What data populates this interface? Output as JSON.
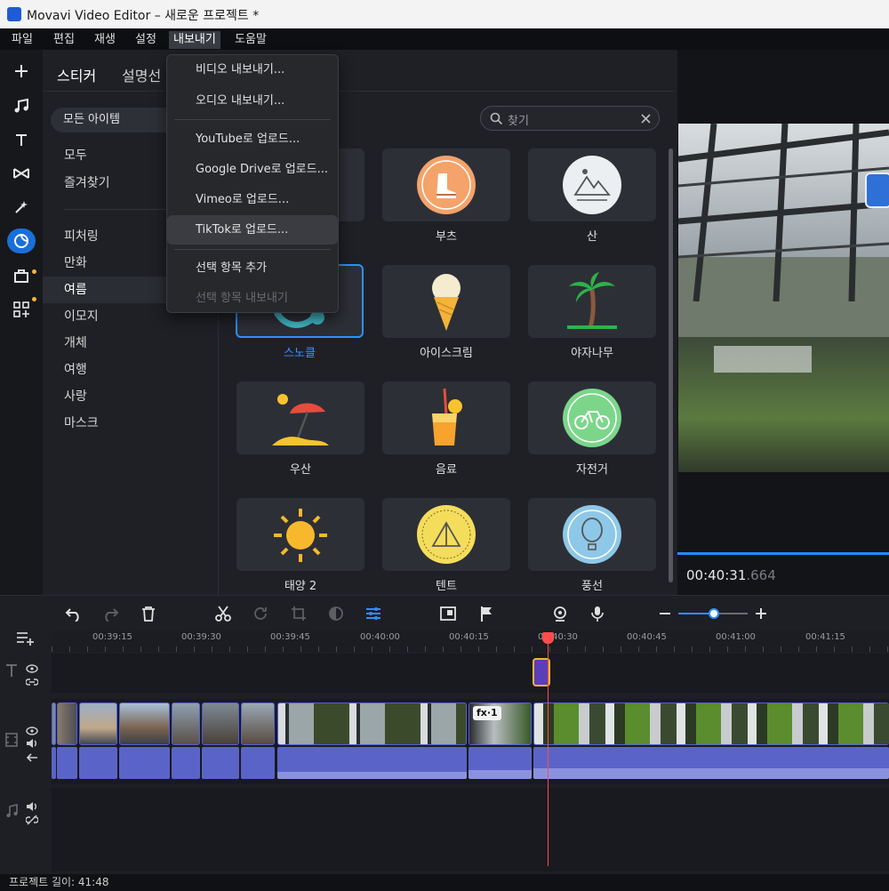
{
  "window": {
    "title": "Movavi Video Editor – 새로운 프로젝트 *"
  },
  "menu": [
    "파일",
    "편집",
    "재생",
    "설정",
    "내보내기",
    "도움말"
  ],
  "panel": {
    "tabs": [
      "스티커",
      "설명선"
    ],
    "filter_pill": "모든 아이템",
    "search_placeholder": "찾기",
    "categories_top": [
      "모두",
      "즐겨찾기"
    ],
    "categories": [
      "피처링",
      "만화",
      "여름",
      "이모지",
      "개체",
      "여행",
      "사랑",
      "마스크"
    ],
    "selected_category": "여름",
    "stickers": [
      "부츠",
      "산",
      "스노클",
      "아이스크림",
      "야자나무",
      "우산",
      "음료",
      "자전거",
      "태양 2",
      "텐트",
      "풍선"
    ]
  },
  "export_menu": {
    "items": [
      "비디오 내보내기...",
      "오디오 내보내기...",
      "YouTube로 업로드...",
      "Google Drive로 업로드...",
      "Vimeo로 업로드...",
      "TikTok로 업로드...",
      "선택 항목 추가",
      "선택 항목 내보내기"
    ],
    "hovered": "TikTok로 업로드...",
    "disabled": "선택 항목 내보내기"
  },
  "preview": {
    "timecode_main": "00:40:31",
    "timecode_frac": ".664"
  },
  "timeline": {
    "ticks": [
      "00:39:15",
      "00:39:30",
      "00:39:45",
      "00:40:00",
      "00:40:15",
      "00:40:30",
      "00:40:45",
      "00:41:00",
      "00:41:15"
    ],
    "fx_badge": "fx·1"
  },
  "status": {
    "project_length": "프로젝트 길이: 41:48"
  },
  "colors": {
    "accent": "#2f8fff",
    "playhead": "#ff4d4d",
    "clip": "#5a64c8",
    "export_active": "#3a3c44"
  }
}
